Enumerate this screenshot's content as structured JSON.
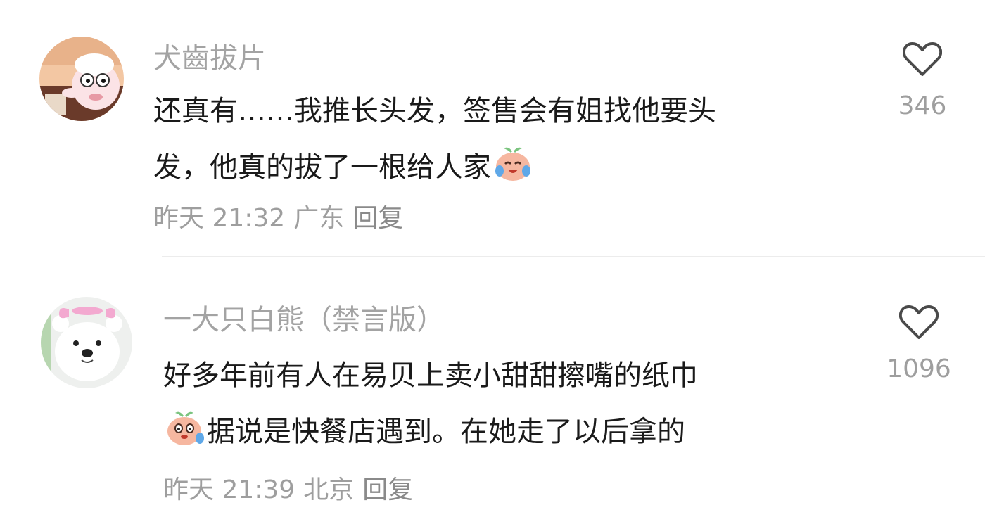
{
  "comments": [
    {
      "username": "犬齒拔片",
      "content_lines": [
        "还真有……我推长头发，签售会有姐找他要头",
        "发，他真的拔了一根给人家"
      ],
      "emoji": "crying-laughing-peach-emoji",
      "time": "昨天 21:32",
      "location": "广东",
      "reply_label": "回复",
      "likes": "346",
      "avatar": "sheep-cartoon-avatar"
    },
    {
      "username": "一大只白熊（禁言版）",
      "content_lines": [
        "好多年前有人在易贝上卖小甜甜擦嘴的纸巾",
        "据说是快餐店遇到。在她走了以后拿的"
      ],
      "emoji": "sweating-peach-emoji",
      "time": "昨天 21:39",
      "location": "北京",
      "reply_label": "回复",
      "likes": "1096",
      "avatar": "white-bear-avatar"
    }
  ],
  "icons": {
    "like": "heart-outline-icon"
  },
  "colors": {
    "username": "#a3a3a3",
    "text": "#1a1a1a",
    "meta": "#9e9e9e",
    "divider": "#ececec"
  }
}
